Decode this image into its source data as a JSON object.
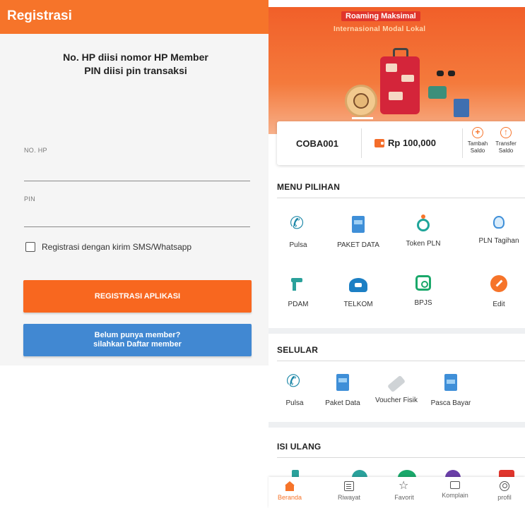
{
  "registration": {
    "appbar_title": "Registrasi",
    "instruction_line1": "No. HP diisi nomor HP Member",
    "instruction_line2": "PIN diisi pin transaksi",
    "phone_label": "NO. HP",
    "pin_label": "PIN",
    "checkbox_label": "Registrasi dengan kirim SMS/Whatsapp",
    "register_button": "REGISTRASI APLIKASI",
    "signup_line1": "Belum punya member?",
    "signup_line2": "silahkan Daftar member"
  },
  "home": {
    "banner": {
      "title1": "Roaming Maksimal",
      "title2": "Internasional Modal Lokal"
    },
    "saldo": {
      "member_id": "COBA001",
      "balance": "Rp 100,000",
      "actions": [
        {
          "label1": "Tambah",
          "label2": "Saldo",
          "icon": "plus-circle-icon"
        },
        {
          "label1": "Transfer",
          "label2": "Saldo",
          "icon": "transfer-circle-icon"
        }
      ]
    },
    "menu_pilihan": {
      "title": "MENU PILIHAN",
      "items": [
        {
          "label": "Pulsa",
          "icon": "phone-signal-icon"
        },
        {
          "label": "PAKET DATA",
          "icon": "data-card-icon"
        },
        {
          "label": "Token PLN",
          "icon": "token-icon"
        },
        {
          "label": "PLN Tagihan",
          "icon": "bulb-icon"
        },
        {
          "label": "PDAM",
          "icon": "water-tap-icon"
        },
        {
          "label": "TELKOM",
          "icon": "telephone-icon"
        },
        {
          "label": "BPJS",
          "icon": "bpjs-icon"
        },
        {
          "label": "Edit",
          "icon": "edit-pencil-icon"
        }
      ]
    },
    "selular": {
      "title": "SELULAR",
      "items": [
        {
          "label": "Pulsa",
          "icon": "phone-signal-icon"
        },
        {
          "label": "Paket Data",
          "icon": "data-card-icon"
        },
        {
          "label": "Voucher Fisik",
          "icon": "voucher-card-icon"
        },
        {
          "label": "Pasca Bayar",
          "icon": "postpaid-card-icon"
        }
      ]
    },
    "isi_ulang": {
      "title": "ISI ULANG"
    },
    "bottom_nav": [
      {
        "label": "Beranda",
        "icon": "home-icon",
        "active": true
      },
      {
        "label": "Riwayat",
        "icon": "history-icon",
        "active": false
      },
      {
        "label": "Favorit",
        "icon": "star-icon",
        "active": false
      },
      {
        "label": "Komplain",
        "icon": "complaint-icon",
        "active": false
      },
      {
        "label": "profil",
        "icon": "profile-icon",
        "active": false
      }
    ]
  },
  "colors": {
    "brand_orange": "#f6742a",
    "button_blue": "#4188d2"
  }
}
